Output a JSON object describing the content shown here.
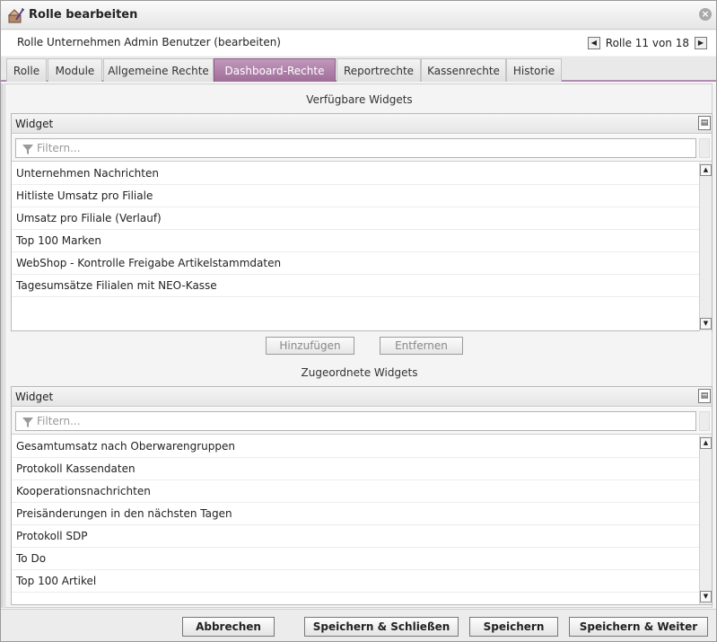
{
  "window": {
    "title": "Rolle bearbeiten",
    "close_glyph": "×"
  },
  "header": {
    "subtitle": "Rolle Unternehmen Admin Benutzer (bearbeiten)",
    "pager_prev": "◀",
    "pager_text": "Rolle 11 von 18",
    "pager_next": "▶"
  },
  "tabs": [
    {
      "label": "Rolle"
    },
    {
      "label": "Module"
    },
    {
      "label": "Allgemeine Rechte"
    },
    {
      "label": "Dashboard-Rechte",
      "active": true
    },
    {
      "label": "Reportrechte"
    },
    {
      "label": "Kassenrechte"
    },
    {
      "label": "Historie"
    }
  ],
  "available": {
    "title": "Verfügbare Widgets",
    "column": "Widget",
    "filter_placeholder": "Filtern...",
    "rows": [
      "Unternehmen Nachrichten",
      "Hitliste Umsatz pro Filiale",
      "Umsatz pro Filiale (Verlauf)",
      "Top 100 Marken",
      "WebShop - Kontrolle Freigabe Artikelstammdaten",
      "Tagesumsätze Filialen mit NEO-Kasse"
    ]
  },
  "actions": {
    "add": "Hinzufügen",
    "remove": "Entfernen"
  },
  "assigned": {
    "title": "Zugeordnete Widgets",
    "column": "Widget",
    "filter_placeholder": "Filtern...",
    "rows": [
      "Gesamtumsatz nach Oberwarengruppen",
      "Protokoll Kassendaten",
      "Kooperationsnachrichten",
      "Preisänderungen in den nächsten Tagen",
      "Protokoll SDP",
      "To Do",
      "Top 100 Artikel"
    ]
  },
  "footer": {
    "cancel": "Abbrechen",
    "save_close": "Speichern & Schließen",
    "save": "Speichern",
    "save_next": "Speichern & Weiter"
  },
  "colors": {
    "accent": "#b07aab",
    "accent_dark": "#9f6d9a"
  },
  "icons": {
    "title": "role-edit-icon",
    "close": "close-icon",
    "filter": "filter-icon",
    "column_menu": "column-menu-icon"
  }
}
